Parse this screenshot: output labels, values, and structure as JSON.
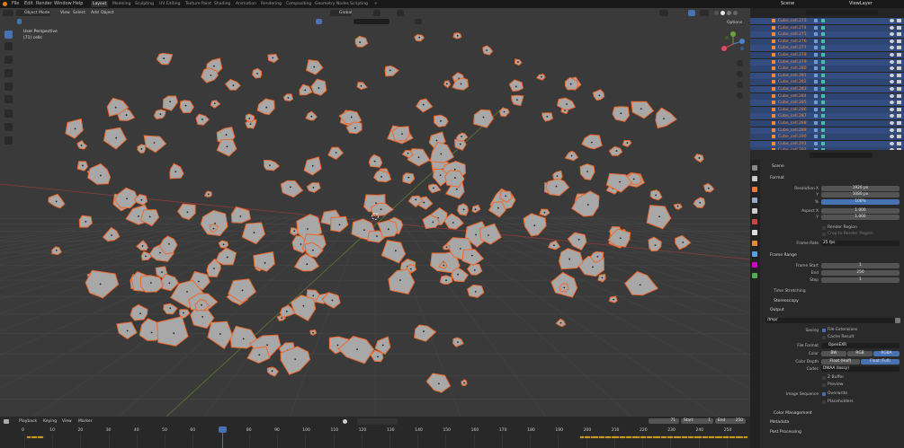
{
  "menubar": {
    "items": [
      "File",
      "Edit",
      "Render",
      "Window",
      "Help"
    ],
    "workspaces": [
      "Layout",
      "Modeling",
      "Sculpting",
      "UV Editing",
      "Texture Paint",
      "Shading",
      "Animation",
      "Rendering",
      "Compositing",
      "Geometry Nodes",
      "Scripting"
    ],
    "add_tab": "+",
    "scene_label": "Scene",
    "view_layer_label": "ViewLayer"
  },
  "viewport": {
    "mode": "Object Mode",
    "menus": [
      "View",
      "Select",
      "Add",
      "Object"
    ],
    "orientation": "Global",
    "options_label": "Options",
    "perspective_label": "User Perspective",
    "collection_label": "(71) cells",
    "gizmo_axes": [
      "X",
      "Y",
      "Z"
    ]
  },
  "outliner": {
    "rows": [
      "Cube_cell.273",
      "Cube_cell.274",
      "Cube_cell.275",
      "Cube_cell.276",
      "Cube_cell.277",
      "Cube_cell.278",
      "Cube_cell.279",
      "Cube_cell.280",
      "Cube_cell.281",
      "Cube_cell.282",
      "Cube_cell.283",
      "Cube_cell.284",
      "Cube_cell.285",
      "Cube_cell.286",
      "Cube_cell.287",
      "Cube_cell.288",
      "Cube_cell.289",
      "Cube_cell.290",
      "Cube_cell.291",
      "Cube_cell.292"
    ]
  },
  "properties": {
    "scene_name": "Scene",
    "format": {
      "title": "Format",
      "resolution_x_label": "Resolution X",
      "resolution_x": "1920 px",
      "y_label": "Y",
      "resolution_y": "1080 px",
      "percent_label": "%",
      "percent": "100%",
      "aspect_x_label": "Aspect X",
      "aspect_x": "1.000",
      "aspect_y_label": "Y",
      "aspect_y": "1.000",
      "render_region": "Render Region",
      "crop_region": "Crop to Render Region",
      "frame_rate_label": "Frame Rate",
      "frame_rate": "25 fps"
    },
    "frame_range": {
      "title": "Frame Range",
      "start_label": "Frame Start",
      "start": "1",
      "end_label": "End",
      "end": "250",
      "step_label": "Step",
      "step": "1",
      "time_stretching": "Time Stretching"
    },
    "stereoscopy": "Stereoscopy",
    "output": {
      "title": "Output",
      "path": "/tmp/",
      "saving_label": "Saving",
      "file_extensions": "File Extensions",
      "cache_result": "Cache Result",
      "file_format_label": "File Format",
      "file_format": "OpenEXR",
      "color_label": "Color",
      "color_options": [
        "BW",
        "RGB",
        "RGBA"
      ],
      "color_depth_label": "Color Depth",
      "depth_options": [
        "Float (Half)",
        "Float (Full)"
      ],
      "codec_label": "Codec",
      "codec": "DWAA (lossy)",
      "z_buffer": "Z Buffer",
      "preview": "Preview",
      "image_sequence_label": "Image Sequence",
      "overwrite": "Overwrite",
      "placeholders": "Placeholders"
    },
    "color_management": "Color Management",
    "metadata": "Metadata",
    "post_processing": "Post Processing"
  },
  "timeline": {
    "menus": [
      "Playback",
      "Keying",
      "View",
      "Marker"
    ],
    "current_frame": "71",
    "start_label": "Start",
    "start": "1",
    "end_label": "End",
    "end": "250",
    "ticks": [
      "0",
      "10",
      "20",
      "30",
      "40",
      "50",
      "60",
      "71",
      "80",
      "90",
      "100",
      "110",
      "120",
      "130",
      "140",
      "150",
      "160",
      "170",
      "180",
      "190",
      "200",
      "210",
      "220",
      "230",
      "240",
      "250"
    ]
  },
  "colors": {
    "viewport_bg": "#3a3a3a",
    "selection_outline": "#f0682a",
    "accent_blue": "#4772b3"
  }
}
